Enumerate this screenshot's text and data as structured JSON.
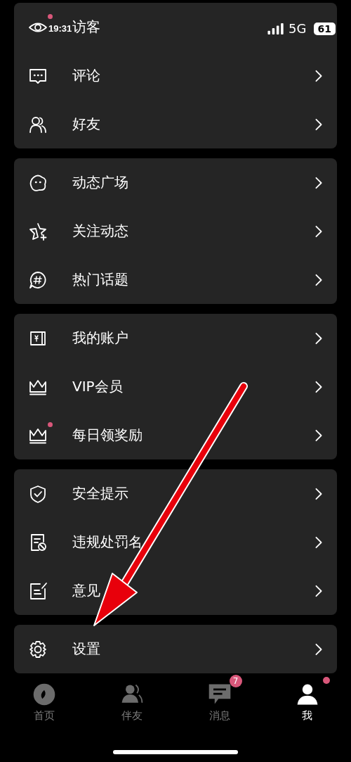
{
  "status_bar": {
    "time": "19:31",
    "network": "5G",
    "battery": "61"
  },
  "groups": [
    {
      "items": [
        {
          "kind": "eye",
          "label": "访客",
          "dot": true
        },
        {
          "kind": "comment",
          "label": "评论",
          "dot": false
        },
        {
          "kind": "friends",
          "label": "好友",
          "dot": false
        }
      ]
    },
    {
      "items": [
        {
          "kind": "blob",
          "label": "动态广场",
          "dot": false
        },
        {
          "kind": "star",
          "label": "关注动态",
          "dot": false
        },
        {
          "kind": "hash",
          "label": "热门话题",
          "dot": false
        }
      ]
    },
    {
      "items": [
        {
          "kind": "wallet",
          "label": "我的账户",
          "dot": false
        },
        {
          "kind": "crown",
          "label": "VIP会员",
          "dot": false
        },
        {
          "kind": "crown",
          "label": "每日领奖励",
          "dot": true
        }
      ]
    },
    {
      "items": [
        {
          "kind": "shield",
          "label": "安全提示",
          "dot": false
        },
        {
          "kind": "ban",
          "label": "违规处罚名",
          "dot": false
        },
        {
          "kind": "edit",
          "label": "意见",
          "dot": false
        }
      ]
    },
    {
      "items": [
        {
          "kind": "gear",
          "label": "设置",
          "dot": false
        }
      ]
    }
  ],
  "tab_bar": [
    {
      "kind": "disc",
      "label": "首页",
      "selected": false,
      "dot": false
    },
    {
      "kind": "people",
      "label": "伴友",
      "selected": false,
      "dot": false
    },
    {
      "kind": "chat",
      "label": "消息",
      "selected": false,
      "dot": false,
      "badge": "7"
    },
    {
      "kind": "person",
      "label": "我",
      "selected": true,
      "dot": true
    }
  ]
}
